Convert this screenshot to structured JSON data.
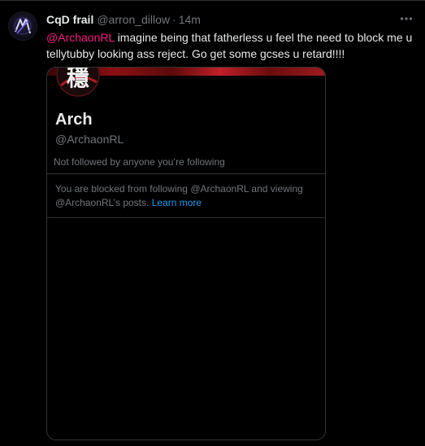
{
  "tweet": {
    "display_name": "CqD frail",
    "handle": "@arron_dillow",
    "separator": "·",
    "time": "14m",
    "mention": "@ArchaonRL",
    "text": " imagine being that fatherless u feel the need to block me u tellytubby looking ass reject. Go get some gcses u retard!!!!"
  },
  "profile_card": {
    "avatar_glyph": "穩",
    "name": "Arch",
    "handle": "@ArchaonRL",
    "followers_note": "Not followed by anyone you’re following",
    "blocked_note": "You are blocked from following @ArchaonRL and viewing @ArchaonRL’s posts.",
    "learn_more": "Learn more"
  },
  "icons": {
    "user_avatar": "avatar-icon",
    "more": "more-horizontal-icon"
  },
  "colors": {
    "background": "#000000",
    "primary_text": "#e7e9ea",
    "secondary_text": "#71767b",
    "mention": "#f91880",
    "link": "#1d9bf0",
    "border": "#2f3336",
    "banner_red": "#c02028"
  }
}
